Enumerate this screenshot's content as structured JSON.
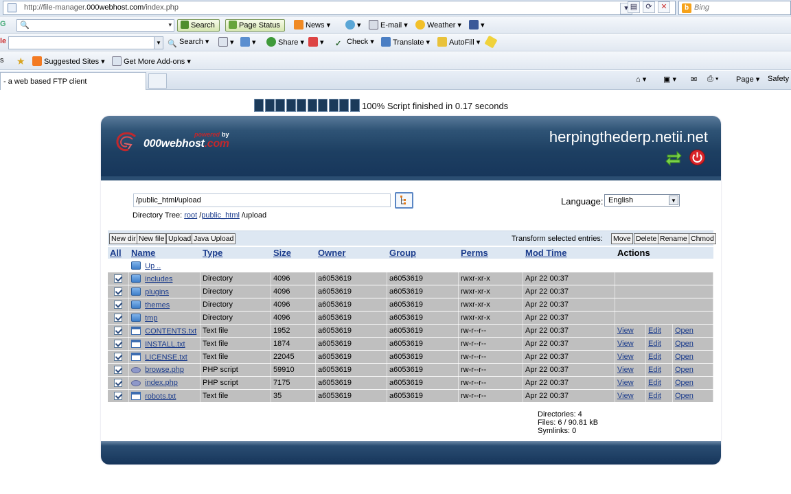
{
  "browser": {
    "url_prefix": "http://file-manager.",
    "url_domain": "000webhost.com",
    "url_path": "/index.php",
    "search_engine": "Bing",
    "toolbar1": {
      "search_label": "Search",
      "page_status_label": "Page Status",
      "news_label": "News",
      "email_label": "E-mail",
      "weather_label": "Weather"
    },
    "toolbar2": {
      "search_label": "Search",
      "share_label": "Share",
      "check_label": "Check",
      "translate_label": "Translate",
      "autofill_label": "AutoFill"
    },
    "favorites": {
      "suggested_sites": "Suggested Sites",
      "get_addons": "Get More Add-ons"
    },
    "tab_title": "- a web based FTP client",
    "commands": {
      "page_label": "Page",
      "safety_label": "Safety"
    }
  },
  "progress": {
    "percent": 100,
    "cells": 10,
    "text": "100% Script finished in 0.17 seconds"
  },
  "header": {
    "powered_by": "by",
    "brand_main": "000webhost",
    "brand_suffix": ".com",
    "hostname": "herpingthederp.netii.net"
  },
  "directory": {
    "path": "/public_html/upload",
    "tree_label": "Directory Tree:",
    "tree": [
      "root",
      "public_html"
    ],
    "tree_current": "/upload"
  },
  "language": {
    "label": "Language:",
    "selected": "English"
  },
  "actions_bar": {
    "new_dir": "New dir",
    "new_file": "New file",
    "upload": "Upload",
    "java_upload": "Java Upload",
    "transform_label": "Transform selected entries:",
    "move": "Move",
    "delete": "Delete",
    "rename": "Rename",
    "chmod": "Chmod"
  },
  "table": {
    "headers": {
      "all": "All",
      "name": "Name",
      "type": "Type",
      "size": "Size",
      "owner": "Owner",
      "group": "Group",
      "perms": "Perms",
      "modtime": "Mod Time",
      "actions": "Actions"
    },
    "up_label": "Up ..",
    "action_labels": {
      "view": "View",
      "edit": "Edit",
      "open": "Open"
    },
    "rows": [
      {
        "name": "includes",
        "type": "Directory",
        "size": "4096",
        "owner": "a6053619",
        "group": "a6053619",
        "perms": "rwxr-xr-x",
        "modtime": "Apr 22 00:37",
        "icon": "folder-icon"
      },
      {
        "name": "plugins",
        "type": "Directory",
        "size": "4096",
        "owner": "a6053619",
        "group": "a6053619",
        "perms": "rwxr-xr-x",
        "modtime": "Apr 22 00:37",
        "icon": "folder-icon"
      },
      {
        "name": "themes",
        "type": "Directory",
        "size": "4096",
        "owner": "a6053619",
        "group": "a6053619",
        "perms": "rwxr-xr-x",
        "modtime": "Apr 22 00:37",
        "icon": "folder-icon"
      },
      {
        "name": "tmp",
        "type": "Directory",
        "size": "4096",
        "owner": "a6053619",
        "group": "a6053619",
        "perms": "rwxr-xr-x",
        "modtime": "Apr 22 00:37",
        "icon": "folder-icon"
      },
      {
        "name": "CONTENTS.txt",
        "type": "Text file",
        "size": "1952",
        "owner": "a6053619",
        "group": "a6053619",
        "perms": "rw-r--r--",
        "modtime": "Apr 22 00:37",
        "icon": "text-file-icon"
      },
      {
        "name": "INSTALL.txt",
        "type": "Text file",
        "size": "1874",
        "owner": "a6053619",
        "group": "a6053619",
        "perms": "rw-r--r--",
        "modtime": "Apr 22 00:37",
        "icon": "text-file-icon"
      },
      {
        "name": "LICENSE.txt",
        "type": "Text file",
        "size": "22045",
        "owner": "a6053619",
        "group": "a6053619",
        "perms": "rw-r--r--",
        "modtime": "Apr 22 00:37",
        "icon": "text-file-icon"
      },
      {
        "name": "browse.php",
        "type": "PHP script",
        "size": "59910",
        "owner": "a6053619",
        "group": "a6053619",
        "perms": "rw-r--r--",
        "modtime": "Apr 22 00:37",
        "icon": "php-file-icon"
      },
      {
        "name": "index.php",
        "type": "PHP script",
        "size": "7175",
        "owner": "a6053619",
        "group": "a6053619",
        "perms": "rw-r--r--",
        "modtime": "Apr 22 00:37",
        "icon": "php-file-icon"
      },
      {
        "name": "robots.txt",
        "type": "Text file",
        "size": "35",
        "owner": "a6053619",
        "group": "a6053619",
        "perms": "rw-r--r--",
        "modtime": "Apr 22 00:37",
        "icon": "text-file-icon"
      }
    ]
  },
  "summary": {
    "directories": "Directories: 4",
    "files": "Files: 6 / 90.81 kB",
    "symlinks": "Symlinks: 0"
  },
  "colors": {
    "banner_dark": "#16355a",
    "row_gray": "#bfbfbf",
    "link_blue": "#1a3b8c",
    "header_row": "#dde7f2",
    "progress_cell": "#1b3a5a"
  }
}
